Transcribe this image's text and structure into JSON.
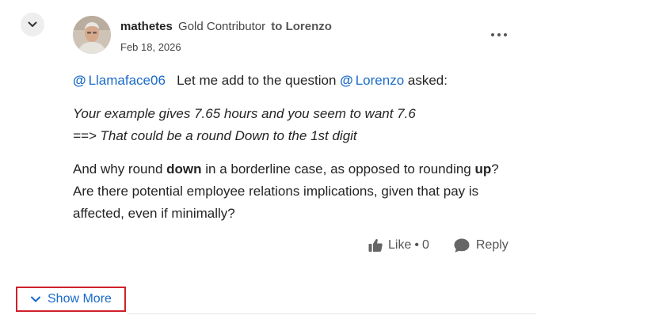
{
  "post": {
    "author": "mathetes",
    "rank": "Gold Contributor",
    "to_label": "to Lorenzo",
    "date": "Feb 18, 2026",
    "mention1": "Llamaface06",
    "intro_text": "Let me add to the question",
    "mention2": "Lorenzo",
    "intro_suffix": "asked:",
    "quote_line1": "Your example gives 7.65 hours and you seem to want 7.6",
    "quote_line2": "==> That could be a round Down to the 1st digit",
    "para_part1": "And why round ",
    "para_bold1": "down",
    "para_part2": " in a borderline case, as opposed to rounding ",
    "para_bold2": "up",
    "para_part3": "? Are there potential employee relations implications, given that pay is affected, even if minimally?"
  },
  "actions": {
    "like_label": "Like",
    "like_sep": "•",
    "like_count": "0",
    "reply_label": "Reply"
  },
  "footer": {
    "show_more_label": "Show More"
  },
  "colors": {
    "accent": "#1b6ac9",
    "highlight_border": "#d0202a"
  }
}
